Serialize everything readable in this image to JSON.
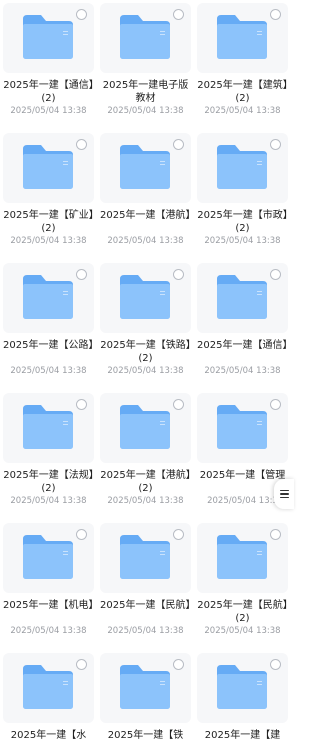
{
  "colors": {
    "folder_front": "#8cc3fb",
    "folder_back": "#66abf5",
    "thumb_bg": "#f6f7f9"
  },
  "items": [
    {
      "name": "2025年一建【通信】(2)",
      "date": "2025/05/04 13:38"
    },
    {
      "name": "2025年一建电子版教材",
      "date": "2025/05/04 13:38"
    },
    {
      "name": "2025年一建【建筑】(2)",
      "date": "2025/05/04 13:38"
    },
    {
      "name": "2025年一建【矿业】(2)",
      "date": "2025/05/04 13:38"
    },
    {
      "name": "2025年一建【港航】",
      "date": "2025/05/04 13:38"
    },
    {
      "name": "2025年一建【市政】(2)",
      "date": "2025/05/04 13:38"
    },
    {
      "name": "2025年一建【公路】",
      "date": "2025/05/04 13:38"
    },
    {
      "name": "2025年一建【铁路】(2)",
      "date": "2025/05/04 13:38"
    },
    {
      "name": "2025年一建【通信】",
      "date": "2025/05/04 13:38"
    },
    {
      "name": "2025年一建【法规】(2)",
      "date": "2025/05/04 13:38"
    },
    {
      "name": "2025年一建【港航】(2)",
      "date": "2025/05/04 13:38"
    },
    {
      "name": "2025年一建【管理",
      "date": "2025/05/04 13:3"
    },
    {
      "name": "2025年一建【机电】",
      "date": "2025/05/04 13:38"
    },
    {
      "name": "2025年一建【民航】",
      "date": "2025/05/04 13:38"
    },
    {
      "name": "2025年一建【民航】(2)",
      "date": "2025/05/04 13:38"
    },
    {
      "name": "2025年一建【水",
      "date": ""
    },
    {
      "name": "2025年一建【铁",
      "date": ""
    },
    {
      "name": "2025年一建【建",
      "date": ""
    }
  ],
  "side_handle": {
    "icon": "menu-icon"
  }
}
